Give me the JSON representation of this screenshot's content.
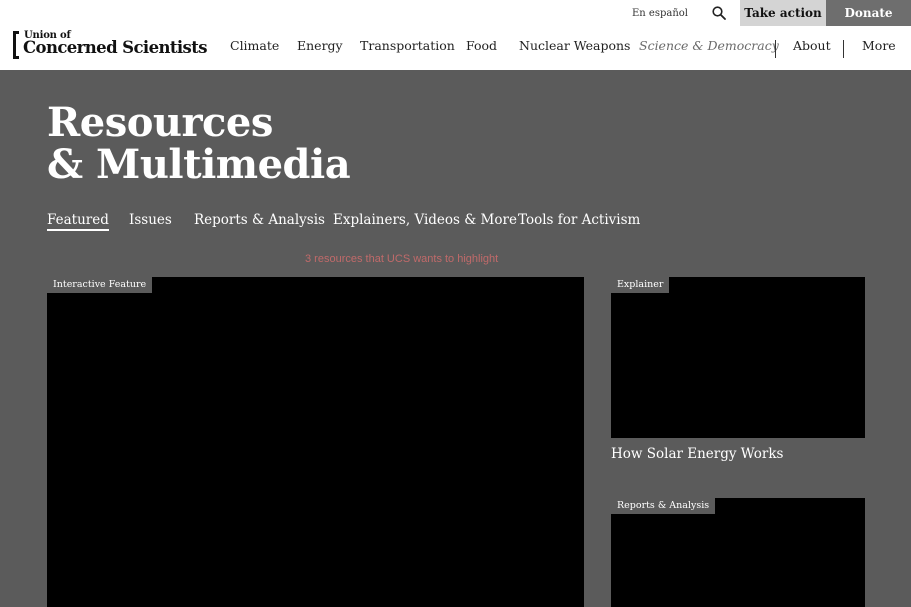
{
  "utility": {
    "language": "En español",
    "search_icon": "search-icon",
    "take_action": "Take action",
    "donate": "Donate"
  },
  "logo": {
    "line1": "Union of",
    "line2": "Concerned Scientists"
  },
  "nav": {
    "items": [
      "Climate",
      "Energy",
      "Transportation",
      "Food",
      "Nuclear Weapons",
      "Science & Democracy",
      "About",
      "More"
    ]
  },
  "hero": {
    "title_line1": "Resources",
    "title_line2": "& Multimedia"
  },
  "subnav": {
    "tabs": [
      "Featured",
      "Issues",
      "Reports & Analysis",
      "Explainers, Videos & More",
      "Tools for Activism"
    ],
    "active": "Featured"
  },
  "featured": {
    "note": "3 resources that UCS wants to highlight",
    "cards": [
      {
        "badge": "Interactive Feature",
        "title": ""
      },
      {
        "badge": "Explainer",
        "title": "How Solar Energy Works"
      },
      {
        "badge": "Reports & Analysis",
        "title": ""
      }
    ]
  },
  "colors": {
    "background": "#5b5b5b",
    "header": "#ffffff",
    "take_action_bg": "#d4d4d4",
    "donate_bg": "#6e6e6e",
    "note_text": "#c06a6a"
  }
}
